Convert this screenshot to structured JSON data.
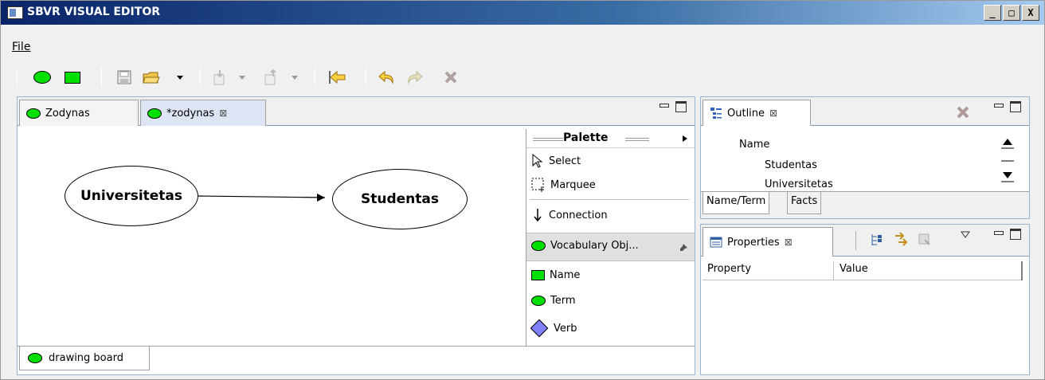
{
  "window": {
    "title": "SBVR VISUAL EDITOR",
    "buttons": {
      "minimize": "_",
      "restore": "□",
      "close": "X"
    }
  },
  "menu": {
    "file": "File"
  },
  "editor": {
    "tabs": [
      {
        "label": "Zodynas",
        "icon": "green-oval-icon"
      },
      {
        "label": "*zodynas",
        "icon": "green-oval-icon"
      }
    ],
    "diagram": {
      "nodes": [
        {
          "label": "Universitetas",
          "shape": "ellipse"
        },
        {
          "label": "Studentas",
          "shape": "ellipse"
        }
      ],
      "connection": "Universitetas → Studentas"
    },
    "bottom_tab": {
      "label": "drawing board",
      "icon": "green-oval-icon"
    }
  },
  "palette": {
    "title": "Palette",
    "tools": [
      {
        "label": "Select",
        "icon": "arrow-cursor-icon"
      },
      {
        "label": "Marquee",
        "icon": "marquee-icon"
      },
      {
        "label": "Connection",
        "icon": "connection-arrow-icon"
      }
    ],
    "drawer": {
      "label": "Vocabulary Obj...",
      "icon": "green-oval-icon"
    },
    "items": [
      {
        "label": "Name",
        "icon": "green-rect-icon"
      },
      {
        "label": "Term",
        "icon": "green-oval-icon"
      },
      {
        "label": "Verb",
        "icon": "blue-diamond-icon"
      }
    ]
  },
  "outline": {
    "tab_label": "Outline",
    "tree": [
      "Name",
      "Studentas",
      "Universitetas"
    ],
    "bottom_tabs": [
      "Name/Term",
      "Facts"
    ]
  },
  "properties": {
    "tab_label": "Properties",
    "columns": [
      "Property",
      "Value"
    ]
  },
  "colors": {
    "node_fill": "#00e000",
    "verb_fill": "#8080f8",
    "title_bar": "#0a246a"
  }
}
